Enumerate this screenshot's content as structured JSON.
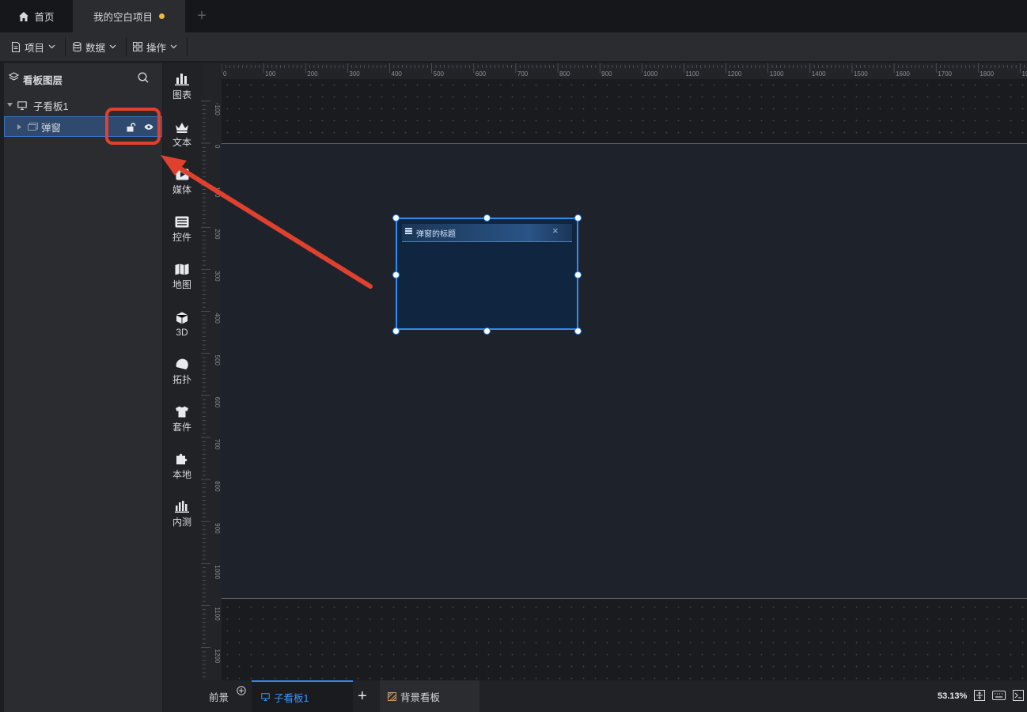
{
  "tabs": {
    "home_label": "首页",
    "project_label": "我的空白项目",
    "add_label": "+"
  },
  "toolbar": {
    "project_label": "项目",
    "data_label": "数据",
    "operate_label": "操作"
  },
  "layers": {
    "title": "看板图层",
    "board_name": "子看板1",
    "item_name": "弹窗"
  },
  "categories": {
    "chart": "图表",
    "text": "文本",
    "media": "媒体",
    "control": "控件",
    "map": "地图",
    "three_d": "3D",
    "topology": "拓扑",
    "kit": "套件",
    "local": "本地",
    "beta": "内测"
  },
  "ruler": {
    "h_ticks": [
      "0",
      "100",
      "200",
      "300",
      "400",
      "500",
      "600",
      "700",
      "800",
      "900",
      "1000",
      "1100",
      "1200",
      "1300",
      "1400",
      "1500",
      "1600",
      "1700",
      "1800",
      "1900"
    ],
    "v_ticks": [
      "-100",
      "0",
      "100",
      "200",
      "300",
      "400",
      "500",
      "600",
      "700",
      "800",
      "900",
      "1000",
      "1100",
      "1200"
    ]
  },
  "dialog": {
    "title": "弹窗的标题",
    "close": "×"
  },
  "bottom": {
    "foreground_label": "前景",
    "subboard_label": "子看板1",
    "add_label": "+",
    "background_label": "背景看板",
    "zoom": "53.13%"
  },
  "colors": {
    "accent": "#2d8cf0",
    "annotation": "#e0412f",
    "unsaved_dot": "#f0b93a"
  }
}
